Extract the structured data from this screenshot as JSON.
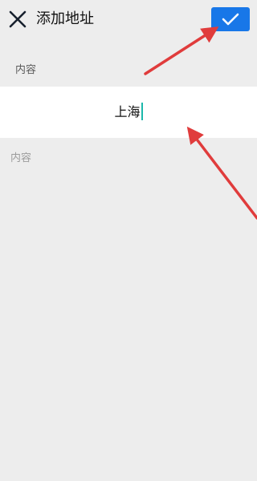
{
  "header": {
    "title": "添加地址",
    "close_icon": "close-icon",
    "confirm_icon": "checkmark-icon"
  },
  "form": {
    "section_label": "内容",
    "input_value": "上海",
    "hint_label": "内容"
  },
  "colors": {
    "background": "#ededed",
    "input_background": "#ffffff",
    "confirm_button": "#1877e8",
    "caret": "#1bb8ab",
    "annotation_arrow": "#e03c3c"
  }
}
